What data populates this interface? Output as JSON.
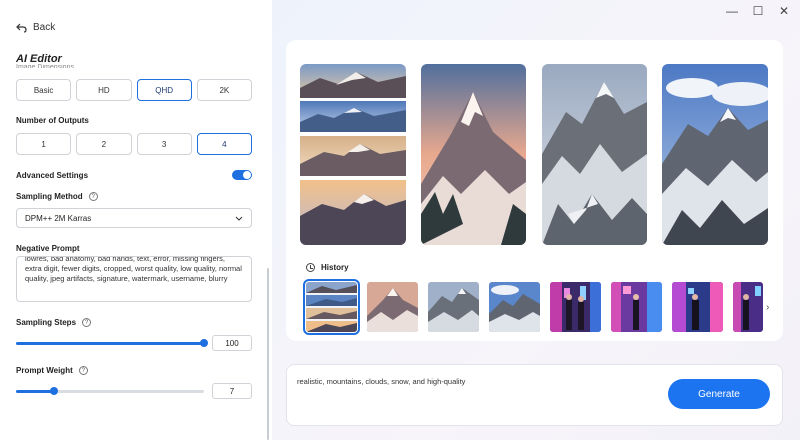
{
  "window": {
    "minimize_icon": "—",
    "maximize_icon": "☐",
    "close_icon": "✕"
  },
  "nav": {
    "back_label": "Back"
  },
  "editor": {
    "title": "AI Editor",
    "cut_label": "Image Dimensions"
  },
  "resolution": {
    "options": [
      "Basic",
      "HD",
      "QHD",
      "2K"
    ],
    "selected": "QHD"
  },
  "outputs": {
    "label": "Number of Outputs",
    "options": [
      "1",
      "2",
      "3",
      "4"
    ],
    "selected": "4"
  },
  "advanced": {
    "label": "Advanced Settings",
    "enabled": true
  },
  "sampling_method": {
    "label": "Sampling Method",
    "value": "DPM++ 2M Karras"
  },
  "negative_prompt": {
    "label": "Negative Prompt",
    "value": "lowres, bad anatomy, bad hands, text, error, missing fingers, extra digit, fewer digits, cropped, worst quality, low quality, normal quality, jpeg artifacts, signature, watermark, username, blurry"
  },
  "sampling_steps": {
    "label": "Sampling Steps",
    "value": "100",
    "fraction": 1.0
  },
  "prompt_weight": {
    "label": "Prompt Weight",
    "value": "7",
    "fraction": 0.2
  },
  "history": {
    "label": "History"
  },
  "prompt": {
    "text": "realistic, mountains, clouds, snow, and high-quality"
  },
  "generate": {
    "label": "Generate"
  },
  "colors": {
    "accent": "#1e6fe0",
    "generate": "#1d74f0"
  }
}
